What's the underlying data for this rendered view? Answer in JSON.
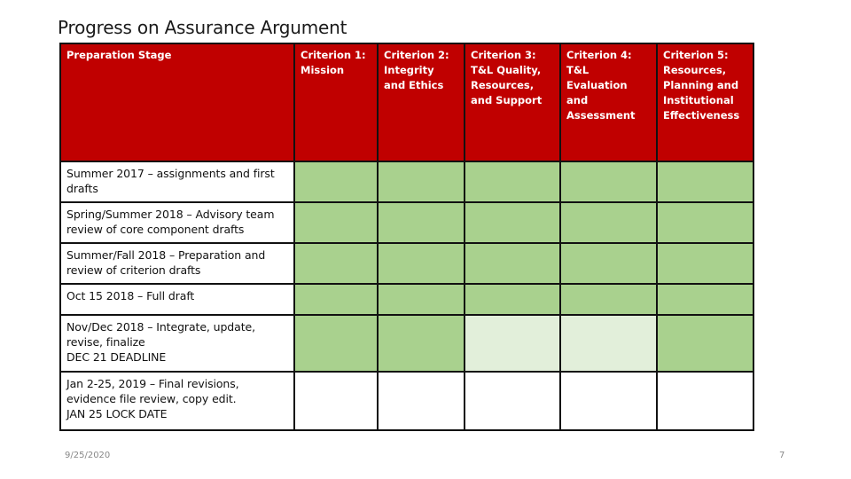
{
  "title": "Progress on Assurance Argument",
  "table": {
    "header": {
      "stage_label": "Preparation Stage",
      "criteria": [
        "Criterion 1: Mission",
        "Criterion 2: Integrity and Ethics",
        "Criterion 3: T&L Quality, Resources, and Support",
        "Criterion 4: T&L Evaluation and Assessment",
        "Criterion 5: Resources, Planning and Institutional Effectiveness"
      ]
    },
    "rows": [
      {
        "stage": [
          "Summer 2017 – assignments and first drafts"
        ],
        "status": [
          "complete",
          "complete",
          "complete",
          "complete",
          "complete"
        ]
      },
      {
        "stage": [
          "Spring/Summer 2018 – Advisory team review of core component drafts"
        ],
        "status": [
          "complete",
          "complete",
          "complete",
          "complete",
          "complete"
        ]
      },
      {
        "stage": [
          "Summer/Fall 2018 – Preparation and review of criterion drafts"
        ],
        "status": [
          "complete",
          "complete",
          "complete",
          "complete",
          "complete"
        ]
      },
      {
        "stage": [
          "Oct 15 2018 – Full draft"
        ],
        "status": [
          "complete",
          "complete",
          "complete",
          "complete",
          "complete"
        ]
      },
      {
        "stage": [
          "Nov/Dec 2018 – Integrate, update, revise, finalize",
          "DEC 21 DEADLINE"
        ],
        "status": [
          "complete",
          "complete",
          "partial",
          "partial",
          "complete"
        ]
      },
      {
        "stage": [
          "Jan 2-25, 2019 – Final revisions, evidence file review, copy edit.",
          "JAN 25 LOCK DATE"
        ],
        "status": [
          "none",
          "none",
          "none",
          "none",
          "none"
        ]
      }
    ]
  },
  "status_colors": {
    "header": "#c00000",
    "complete": "#a9d18e",
    "partial": "#e2efda",
    "none": "#ffffff"
  },
  "footer": {
    "date": "9/25/2020",
    "page_number": "7"
  }
}
